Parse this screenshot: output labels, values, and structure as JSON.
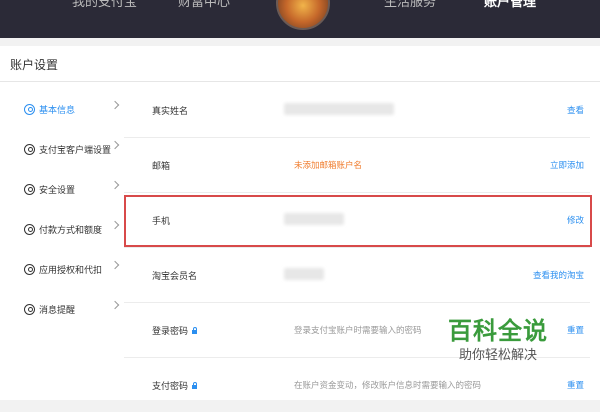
{
  "topbar": {
    "nav": [
      "我的支付宝",
      "财富中心",
      "生活服务",
      "账户管理"
    ]
  },
  "card": {
    "title": "账户设置"
  },
  "sidebar": {
    "items": [
      {
        "label": "基本信息",
        "icon": "user-icon",
        "active": true
      },
      {
        "label": "支付宝客户端设置",
        "icon": "phone-icon"
      },
      {
        "label": "安全设置",
        "icon": "shield-icon"
      },
      {
        "label": "付款方式和额度",
        "icon": "yuan-icon"
      },
      {
        "label": "应用授权和代扣",
        "icon": "check-icon"
      },
      {
        "label": "消息提醒",
        "icon": "message-icon"
      }
    ]
  },
  "rows": [
    {
      "label": "真实姓名",
      "value": "",
      "action": "查看"
    },
    {
      "label": "邮箱",
      "value": "未添加邮箱账户名",
      "action": "立即添加"
    },
    {
      "label": "手机",
      "value": "",
      "action": "修改"
    },
    {
      "label": "淘宝会员名",
      "value": "",
      "action": "查看我的淘宝"
    },
    {
      "label": "登录密码",
      "value": "登录支付宝账户时需要输入的密码",
      "action": "重置"
    },
    {
      "label": "支付密码",
      "value": "在账户资金变动，修改账户信息时需要输入的密码",
      "action": "重置"
    }
  ],
  "colors": {
    "accent": "#2b8ff0",
    "warn": "#f07b2b",
    "highlight": "#d84a4a",
    "topbar": "#2b2a37"
  },
  "watermark": {
    "title": "百科全说",
    "subtitle": "助你轻松解决"
  }
}
